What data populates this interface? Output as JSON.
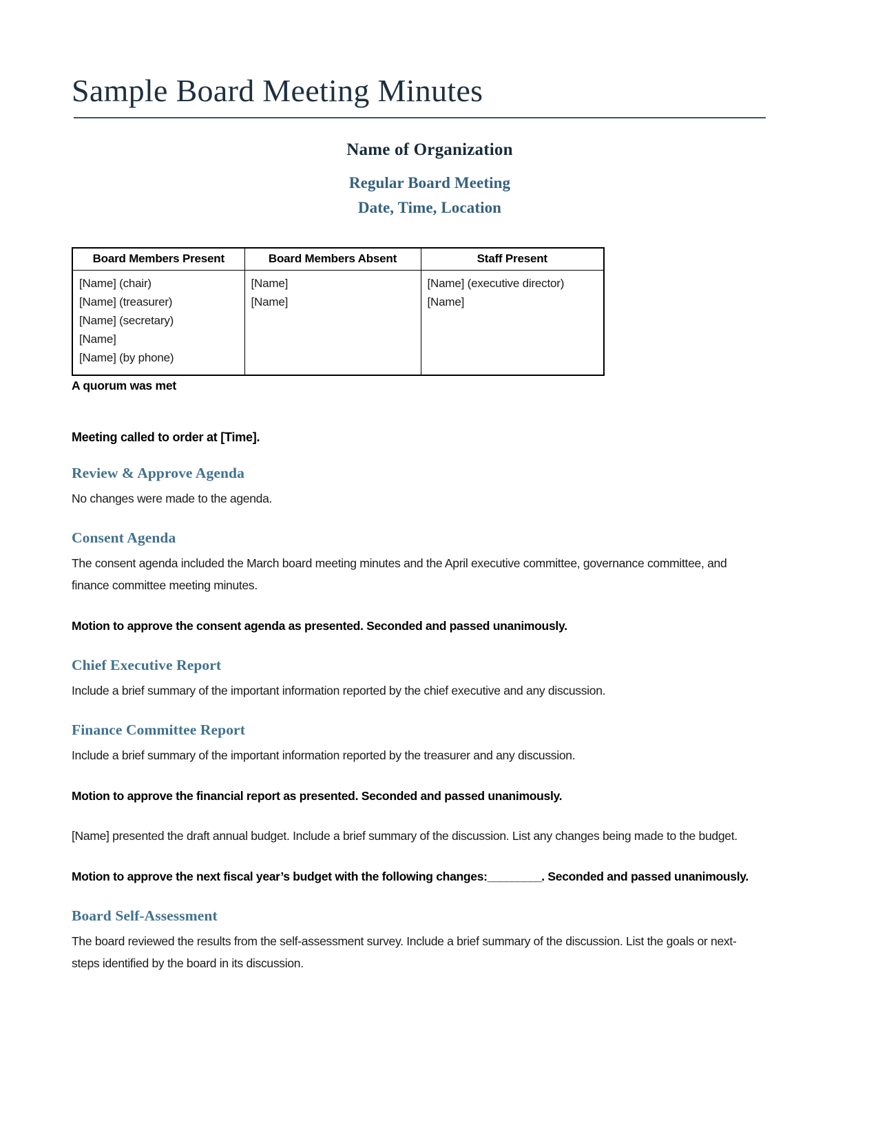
{
  "document": {
    "title": "Sample Board Meeting Minutes",
    "organization": "Name of Organization",
    "meeting_type": "Regular Board Meeting",
    "datetime_location": "Date, Time, Location"
  },
  "colors": {
    "title": "#1f3040",
    "rule": "#40545f",
    "org_name": "#172b3a",
    "meeting_subtitle": "#35617f",
    "section_heading": "#41718f",
    "body_text": "#1a1a1a",
    "table_border": "#000000"
  },
  "attendance_table": {
    "headers": [
      "Board Members Present",
      "Board Members Absent",
      "Staff Present"
    ],
    "columns": [
      [
        "[Name] (chair)",
        "[Name] (treasurer)",
        "[Name] (secretary)",
        "[Name]",
        "[Name] (by phone)"
      ],
      [
        "[Name]",
        "[Name]"
      ],
      [
        "[Name] (executive director)",
        "[Name]"
      ]
    ]
  },
  "quorum_note": "A quorum was met",
  "called_to_order": "Meeting called to order at [Time].",
  "sections": [
    {
      "heading": "Review & Approve Agenda",
      "body": "No changes were made to the agenda."
    },
    {
      "heading": "Consent Agenda",
      "body": "The consent agenda included the March board meeting minutes and the April executive committee, governance committee, and finance committee meeting minutes.",
      "motion": "Motion to approve the consent agenda as presented. Seconded and passed unanimously."
    },
    {
      "heading": "Chief Executive Report",
      "body": "Include a brief summary of the important information reported by the chief executive and any discussion."
    },
    {
      "heading": "Finance Committee Report",
      "body": "Include a brief summary of the important information reported by the treasurer and any discussion.",
      "motion": "Motion to approve the financial report as presented. Seconded and passed unanimously.",
      "paragraph": "[Name] presented the draft annual budget. Include a brief summary of the discussion. List any changes being made to the budget.",
      "motion2_prefix": "Motion to approve the next fiscal year’s budget with the following changes:",
      "motion2_blank": "_________",
      "motion2_suffix": ". Seconded and passed unanimously."
    },
    {
      "heading": "Board Self-Assessment",
      "body": "The board reviewed the results from the self-assessment survey. Include a brief summary of the discussion. List the goals or next-steps identified by the board in its discussion."
    }
  ]
}
